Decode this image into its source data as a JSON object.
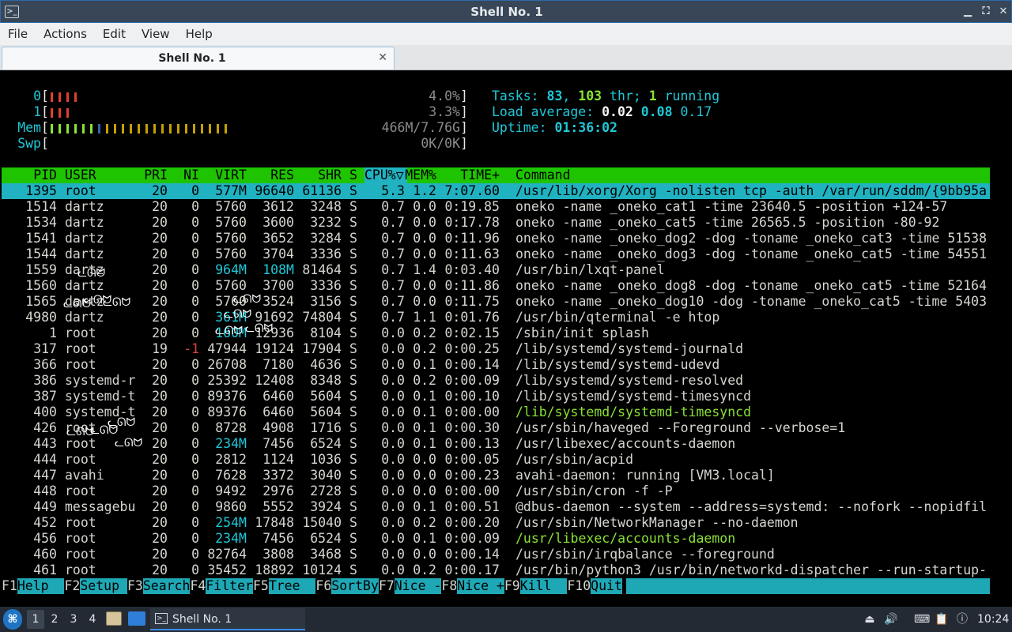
{
  "window": {
    "title": "Shell No. 1",
    "icon_name": "terminal-icon",
    "minimize": "▁",
    "maximize": "⛶",
    "close": "✕"
  },
  "menu": [
    "File",
    "Actions",
    "Edit",
    "View",
    "Help"
  ],
  "tab": {
    "label": "Shell No. 1",
    "close": "✕"
  },
  "htop": {
    "cpu0": {
      "label": "0",
      "value": "4.0%",
      "bars": [
        "#e04030",
        "#e04030",
        "#e04030",
        "#e04030"
      ]
    },
    "cpu1": {
      "label": "1",
      "value": "3.3%",
      "bars": [
        "#e04030",
        "#e04030",
        "#e04030"
      ]
    },
    "mem": {
      "label": "Mem",
      "value": "466M/7.76G",
      "bars": [
        "#8ae234",
        "#8ae234",
        "#8ae234",
        "#8ae234",
        "#8ae234",
        "#8ae234",
        "#3465a4",
        "#c4a000",
        "#c4a000",
        "#c4a000",
        "#c4a000",
        "#c4a000",
        "#c4a000",
        "#c4a000",
        "#c4a000",
        "#c4a000",
        "#c4a000",
        "#c4a000",
        "#c4a000",
        "#c4a000",
        "#c4a000",
        "#c4a000",
        "#c4a000"
      ]
    },
    "swp": {
      "label": "Swp",
      "value": "0K/0K"
    },
    "tasks": {
      "label": "Tasks: ",
      "count": "83",
      "sep1": ", ",
      "threads": "103",
      "sep2": " thr; ",
      "running": "1",
      "tail": " running"
    },
    "load": {
      "label": "Load average: ",
      "one": "0.02",
      "five": "0.08",
      "fifteen": "0.17"
    },
    "uptime": {
      "label": "Uptime: ",
      "value": "01:36:02"
    },
    "columns": [
      "PID",
      "USER",
      "PRI",
      "NI",
      "VIRT",
      "RES",
      "SHR",
      "S",
      "CPU%▽",
      "MEM%",
      "TIME+",
      "Command"
    ],
    "rows": [
      {
        "pid": "1395",
        "user": "root",
        "pri": "20",
        "ni": "0",
        "virt": "577M",
        "res": "96640",
        "shr": "61136",
        "s": "S",
        "cpu": "5.3",
        "mem": "1.2",
        "time": "7:07.60",
        "cmd": "/usr/lib/xorg/Xorg -nolisten tcp -auth /var/run/sddm/{9bb95a",
        "selected": true
      },
      {
        "pid": "1514",
        "user": "dartz",
        "pri": "20",
        "ni": "0",
        "virt": "5760",
        "res": "3612",
        "shr": "3248",
        "s": "S",
        "cpu": "0.7",
        "mem": "0.0",
        "time": "0:19.85",
        "cmd": "oneko -name _oneko_cat1 -time 23640.5 -position +124-57"
      },
      {
        "pid": "1534",
        "user": "dartz",
        "pri": "20",
        "ni": "0",
        "virt": "5760",
        "res": "3600",
        "shr": "3232",
        "s": "S",
        "cpu": "0.7",
        "mem": "0.0",
        "time": "0:17.78",
        "cmd": "oneko -name _oneko_cat5 -time 26565.5 -position -80-92"
      },
      {
        "pid": "1541",
        "user": "dartz",
        "pri": "20",
        "ni": "0",
        "virt": "5760",
        "res": "3652",
        "shr": "3284",
        "s": "S",
        "cpu": "0.7",
        "mem": "0.0",
        "time": "0:11.96",
        "cmd": "oneko -name _oneko_dog2 -dog -toname _oneko_cat3 -time 51538"
      },
      {
        "pid": "1544",
        "user": "dartz",
        "pri": "20",
        "ni": "0",
        "virt": "5760",
        "res": "3704",
        "shr": "3336",
        "s": "S",
        "cpu": "0.7",
        "mem": "0.0",
        "time": "0:11.63",
        "cmd": "oneko -name _oneko_dog3 -dog -toname _oneko_cat5 -time 54551"
      },
      {
        "pid": "1559",
        "user": "dartz",
        "pri": "20",
        "ni": "0",
        "virt": "964M",
        "res": "108M",
        "shr": "81464",
        "s": "S",
        "cpu": "0.7",
        "mem": "1.4",
        "time": "0:03.40",
        "cmd": "/usr/bin/lxqt-panel"
      },
      {
        "pid": "1560",
        "user": "dartz",
        "pri": "20",
        "ni": "0",
        "virt": "5760",
        "res": "3700",
        "shr": "3336",
        "s": "S",
        "cpu": "0.7",
        "mem": "0.0",
        "time": "0:11.86",
        "cmd": "oneko -name _oneko_dog8 -dog -toname _oneko_cat5 -time 52164"
      },
      {
        "pid": "1565",
        "user": "dartz",
        "pri": "20",
        "ni": "0",
        "virt": "5760",
        "res": "3524",
        "shr": "3156",
        "s": "S",
        "cpu": "0.7",
        "mem": "0.0",
        "time": "0:11.75",
        "cmd": "oneko -name _oneko_dog10 -dog -toname _oneko_cat5 -time 5403"
      },
      {
        "pid": "4980",
        "user": "dartz",
        "pri": "20",
        "ni": "0",
        "virt": "361M",
        "res": "91692",
        "shr": "74804",
        "s": "S",
        "cpu": "0.7",
        "mem": "1.1",
        "time": "0:01.76",
        "cmd": "/usr/bin/qterminal -e htop"
      },
      {
        "pid": "1",
        "user": "root",
        "pri": "20",
        "ni": "0",
        "virt": "160M",
        "res": "12936",
        "shr": "8104",
        "s": "S",
        "cpu": "0.0",
        "mem": "0.2",
        "time": "0:02.15",
        "cmd": "/sbin/init splash"
      },
      {
        "pid": "317",
        "user": "root",
        "pri": "19",
        "ni": "-1",
        "virt": "47944",
        "res": "19124",
        "shr": "17904",
        "s": "S",
        "cpu": "0.0",
        "mem": "0.2",
        "time": "0:00.25",
        "cmd": "/lib/systemd/systemd-journald"
      },
      {
        "pid": "366",
        "user": "root",
        "pri": "20",
        "ni": "0",
        "virt": "26708",
        "res": "7180",
        "shr": "4636",
        "s": "S",
        "cpu": "0.0",
        "mem": "0.1",
        "time": "0:00.14",
        "cmd": "/lib/systemd/systemd-udevd"
      },
      {
        "pid": "386",
        "user": "systemd-r",
        "pri": "20",
        "ni": "0",
        "virt": "25392",
        "res": "12408",
        "shr": "8348",
        "s": "S",
        "cpu": "0.0",
        "mem": "0.2",
        "time": "0:00.09",
        "cmd": "/lib/systemd/systemd-resolved"
      },
      {
        "pid": "387",
        "user": "systemd-t",
        "pri": "20",
        "ni": "0",
        "virt": "89376",
        "res": "6460",
        "shr": "5604",
        "s": "S",
        "cpu": "0.0",
        "mem": "0.1",
        "time": "0:00.10",
        "cmd": "/lib/systemd/systemd-timesyncd"
      },
      {
        "pid": "400",
        "user": "systemd-t",
        "pri": "20",
        "ni": "0",
        "virt": "89376",
        "res": "6460",
        "shr": "5604",
        "s": "S",
        "cpu": "0.0",
        "mem": "0.1",
        "time": "0:00.00",
        "cmd": "/lib/systemd/systemd-timesyncd",
        "thread": true
      },
      {
        "pid": "426",
        "user": "root",
        "pri": "20",
        "ni": "0",
        "virt": "8728",
        "res": "4908",
        "shr": "1716",
        "s": "S",
        "cpu": "0.0",
        "mem": "0.1",
        "time": "0:00.30",
        "cmd": "/usr/sbin/haveged --Foreground --verbose=1"
      },
      {
        "pid": "443",
        "user": "root",
        "pri": "20",
        "ni": "0",
        "virt": "234M",
        "res": "7456",
        "shr": "6524",
        "s": "S",
        "cpu": "0.0",
        "mem": "0.1",
        "time": "0:00.13",
        "cmd": "/usr/libexec/accounts-daemon"
      },
      {
        "pid": "444",
        "user": "root",
        "pri": "20",
        "ni": "0",
        "virt": "2812",
        "res": "1124",
        "shr": "1036",
        "s": "S",
        "cpu": "0.0",
        "mem": "0.0",
        "time": "0:00.05",
        "cmd": "/usr/sbin/acpid"
      },
      {
        "pid": "447",
        "user": "avahi",
        "pri": "20",
        "ni": "0",
        "virt": "7628",
        "res": "3372",
        "shr": "3040",
        "s": "S",
        "cpu": "0.0",
        "mem": "0.0",
        "time": "0:00.23",
        "cmd": "avahi-daemon: running [VM3.local]"
      },
      {
        "pid": "448",
        "user": "root",
        "pri": "20",
        "ni": "0",
        "virt": "9492",
        "res": "2976",
        "shr": "2728",
        "s": "S",
        "cpu": "0.0",
        "mem": "0.0",
        "time": "0:00.00",
        "cmd": "/usr/sbin/cron -f -P"
      },
      {
        "pid": "449",
        "user": "messagebu",
        "pri": "20",
        "ni": "0",
        "virt": "9860",
        "res": "5552",
        "shr": "3924",
        "s": "S",
        "cpu": "0.0",
        "mem": "0.1",
        "time": "0:00.51",
        "cmd": "@dbus-daemon --system --address=systemd: --nofork --nopidfil"
      },
      {
        "pid": "452",
        "user": "root",
        "pri": "20",
        "ni": "0",
        "virt": "254M",
        "res": "17848",
        "shr": "15040",
        "s": "S",
        "cpu": "0.0",
        "mem": "0.2",
        "time": "0:00.20",
        "cmd": "/usr/sbin/NetworkManager --no-daemon"
      },
      {
        "pid": "456",
        "user": "root",
        "pri": "20",
        "ni": "0",
        "virt": "234M",
        "res": "7456",
        "shr": "6524",
        "s": "S",
        "cpu": "0.0",
        "mem": "0.1",
        "time": "0:00.09",
        "cmd": "/usr/libexec/accounts-daemon",
        "thread": true
      },
      {
        "pid": "460",
        "user": "root",
        "pri": "20",
        "ni": "0",
        "virt": "82764",
        "res": "3808",
        "shr": "3468",
        "s": "S",
        "cpu": "0.0",
        "mem": "0.0",
        "time": "0:00.14",
        "cmd": "/usr/sbin/irqbalance --foreground"
      },
      {
        "pid": "461",
        "user": "root",
        "pri": "20",
        "ni": "0",
        "virt": "35452",
        "res": "18892",
        "shr": "10124",
        "s": "S",
        "cpu": "0.0",
        "mem": "0.2",
        "time": "0:00.17",
        "cmd": "/usr/bin/python3 /usr/bin/networkd-dispatcher --run-startup-"
      }
    ],
    "fkeys": [
      {
        "key": "F1",
        "label": "Help  "
      },
      {
        "key": "F2",
        "label": "Setup "
      },
      {
        "key": "F3",
        "label": "Search"
      },
      {
        "key": "F4",
        "label": "Filter"
      },
      {
        "key": "F5",
        "label": "Tree  "
      },
      {
        "key": "F6",
        "label": "SortBy"
      },
      {
        "key": "F7",
        "label": "Nice -"
      },
      {
        "key": "F8",
        "label": "Nice +"
      },
      {
        "key": "F9",
        "label": "Kill  "
      },
      {
        "key": "F10",
        "label": "Quit"
      }
    ]
  },
  "taskbar": {
    "start_icon": "lxqt-start-icon",
    "desktops": [
      "1",
      "2",
      "3",
      "4"
    ],
    "task_label": "Shell No. 1",
    "clock": "10:24",
    "tray_icons": [
      "network-icon",
      "volume-icon",
      "keyboard-icon",
      "clipboard-icon",
      "update-notifier-icon"
    ]
  },
  "oneko_sprites": "ᓚᘏᗢ"
}
